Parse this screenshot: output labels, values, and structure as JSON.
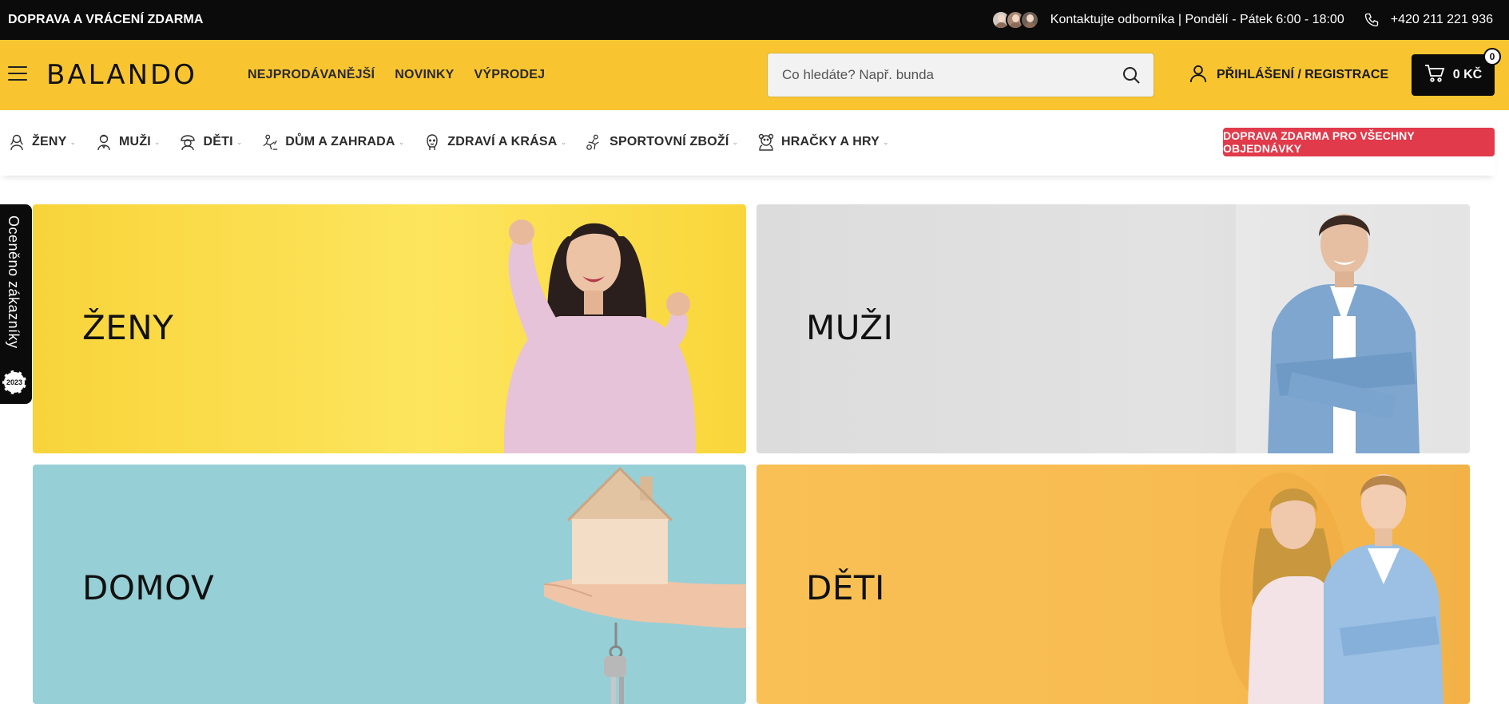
{
  "topbar": {
    "shipping_text": "DOPRAVA A VRÁCENÍ ZDARMA",
    "contact_text": "Kontaktujte odborníka | Pondělí - Pátek 6:00 - 18:00",
    "phone": "+420 211 221 936"
  },
  "header": {
    "logo": "BALANDO",
    "nav": [
      "NEJPRODÁVANĚJŠÍ",
      "NOVINKY",
      "VÝPRODEJ"
    ],
    "search_placeholder": "Co hledáte? Např. bunda",
    "login_label": "PŘIHLÁŠENÍ / REGISTRACE",
    "cart_total": "0 KČ",
    "cart_count": "0"
  },
  "categories": [
    {
      "label": "ŽENY",
      "icon": "woman-icon"
    },
    {
      "label": "MUŽI",
      "icon": "man-icon"
    },
    {
      "label": "DĚTI",
      "icon": "child-icon"
    },
    {
      "label": "DŮM A ZAHRADA",
      "icon": "house-garden-icon"
    },
    {
      "label": "ZDRAVÍ A KRÁSA",
      "icon": "beauty-icon"
    },
    {
      "label": "SPORTOVNÍ ZBOŽÍ",
      "icon": "sport-icon"
    },
    {
      "label": "HRAČKY A HRY",
      "icon": "toy-icon"
    }
  ],
  "promo_text": "DOPRAVA ZDARMA PRO VŠECHNY OBJEDNÁVKY",
  "side_badge": {
    "text": "Oceněno zákazníky",
    "seal": "2023"
  },
  "tiles": {
    "women": "ŽENY",
    "men": "MUŽI",
    "home": "DOMOV",
    "kids": "DĚTI"
  },
  "colors": {
    "topbar_bg": "#0b0b0b",
    "header_bg": "#f8c531",
    "promo_bg": "#e03a4b",
    "women_tile": "#fde55e",
    "men_tile": "#dcdcdc",
    "home_tile": "#97cfd6",
    "kids_tile": "#f9c055"
  }
}
